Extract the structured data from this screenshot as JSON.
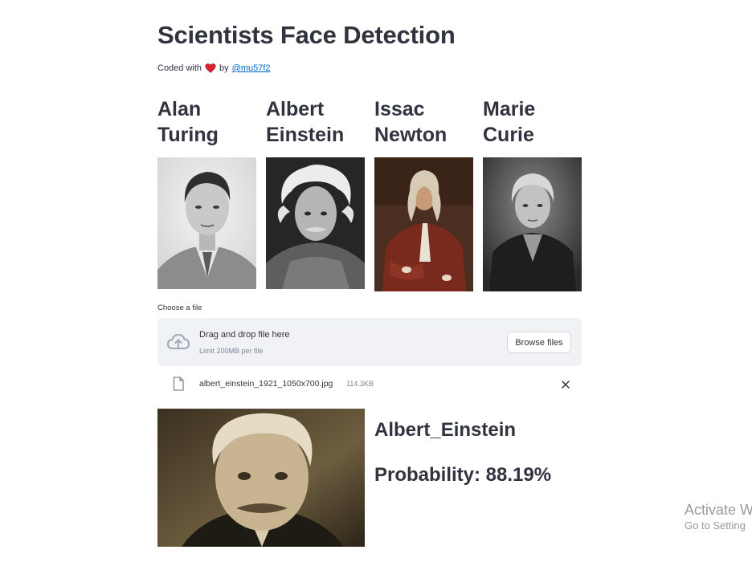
{
  "header": {
    "title": "Scientists Face Detection",
    "byline_prefix": "Coded with",
    "byline_by": "by",
    "author_link": "@mu57f2",
    "heart_icon": "heart-icon",
    "heart_color": "#e0202f"
  },
  "scientists": [
    {
      "name_line1": "Alan",
      "name_line2": "Turing"
    },
    {
      "name_line1": "Albert",
      "name_line2": "Einstein"
    },
    {
      "name_line1": "Issac",
      "name_line2": "Newton"
    },
    {
      "name_line1": "Marie",
      "name_line2": "Curie"
    }
  ],
  "uploader": {
    "label": "Choose a file",
    "drop_text": "Drag and drop file here",
    "limit_text": "Limit 200MB per file",
    "browse_label": "Browse files",
    "file_name": "albert_einstein_1921_1050x700.jpg",
    "file_size": "114.3KB"
  },
  "result": {
    "name": "Albert_Einstein",
    "probability": "Probability: 88.19%"
  },
  "watermark": {
    "title": "Activate W",
    "subtitle": "Go to Setting"
  },
  "colors": {
    "text": "#31333f",
    "link": "#0068c9",
    "dropzone_bg": "#f0f2f6",
    "muted": "#808495"
  }
}
